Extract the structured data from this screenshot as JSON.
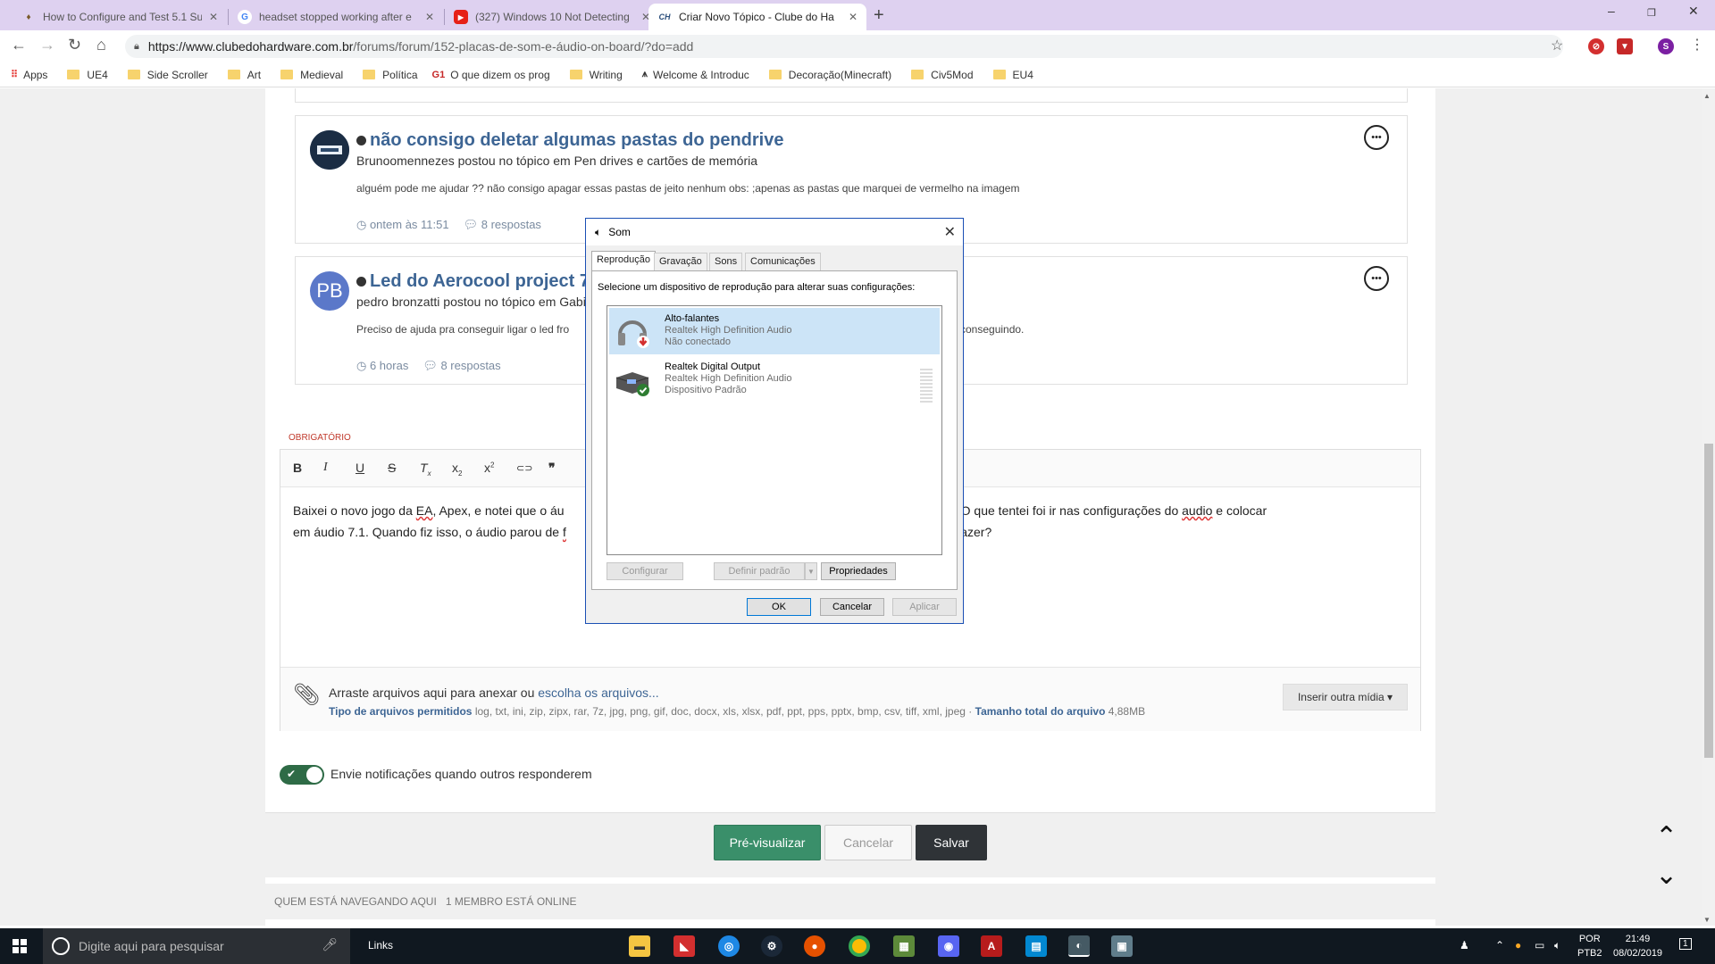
{
  "tabs": [
    {
      "title": "How to Configure and Test 5.1 Su"
    },
    {
      "title": "headset stopped working after e"
    },
    {
      "title": "(327) Windows 10 Not Detecting"
    },
    {
      "title": "Criar Novo Tópico - Clube do Ha"
    }
  ],
  "url": {
    "host": "https://www.clubedohardware.com.br",
    "path": "/forums/forum/152-placas-de-som-e-áudio-on-board/?do=add"
  },
  "bookmarks": [
    "Apps",
    "UE4",
    "Side Scroller",
    "Art",
    "Medieval",
    "Política",
    "O que dizem os prog",
    "Writing",
    "Welcome & Introduc",
    "Decoração(Minecraft)",
    "Civ5Mod",
    "EU4"
  ],
  "profile_initial": "S",
  "posts": [
    {
      "title": "não consigo deletar algumas pastas do pendrive",
      "author_line": "Brunoomennezes postou no tópico em Pen drives e cartões de memória",
      "excerpt": "alguém pode me ajudar ?? não consigo apagar essas pastas de jeito nenhum obs: ;apenas as pastas que marquei de vermelho na imagem",
      "time": "◷ ontem às 11:51",
      "replies": "8 respostas"
    },
    {
      "initials": "PB",
      "title": "Led do Aerocool project 7",
      "author_line": "pedro bronzatti postou no tópico em Gabi",
      "excerpt": "Preciso de ajuda pra conseguir ligar o led fro",
      "excerpt_tail": "conseguindo.",
      "time": "◷ 6 horas",
      "replies": "8 respostas"
    }
  ],
  "required_label": "OBRIGATÓRIO",
  "editor": {
    "line1_a": "Baixei o novo jogo da ",
    "line1_ea": "EA",
    "line1_b": ", Apex, e notei que o áu",
    "line1_c": "s que vi na internet. O que tentei foi ir nas configurações do ",
    "line1_audio": "audio",
    "line1_d": " e colocar",
    "line2_a": "em áudio 7.1. Quando fiz isso, o áudio parou de ",
    "line2_f": "f",
    "line2_b": "ue fazer?"
  },
  "attach": {
    "text": "Arraste arquivos aqui para anexar ou ",
    "link": "escolha os arquivos...",
    "types_label": "Tipo de arquivos permitidos",
    "types": "log, txt, ini, zip, zipx, rar, 7z, jpg, png, gif, doc, docx, xls, xlsx, pdf, ppt, pps, pptx, bmp, csv, tiff, xml, jpeg · ",
    "size_label": "Tamanho total do arquivo",
    "size": "4,88MB",
    "insert_btn": "Inserir outra mídia ▾"
  },
  "notify_label": "Envie notificações quando outros responderem",
  "actions": {
    "preview": "Pré-visualizar",
    "cancel": "Cancelar",
    "save": "Salvar"
  },
  "whos": {
    "label": "QUEM ESTÁ NAVEGANDO AQUI",
    "count": "1 MEMBRO ESTÁ ONLINE"
  },
  "dialog": {
    "title": "Som",
    "tabs": [
      "Reprodução",
      "Gravação",
      "Sons",
      "Comunicações"
    ],
    "instruction": "Selecione um dispositivo de reprodução para alterar suas configurações:",
    "devices": [
      {
        "name": "Alto-falantes",
        "driver": "Realtek High Definition Audio",
        "status": "Não conectado"
      },
      {
        "name": "Realtek Digital Output",
        "driver": "Realtek High Definition Audio",
        "status": "Dispositivo Padrão"
      }
    ],
    "configure": "Configurar",
    "set_default": "Definir padrão",
    "properties": "Propriedades",
    "ok": "OK",
    "cancel": "Cancelar",
    "apply": "Aplicar"
  },
  "taskbar": {
    "search_placeholder": "Digite aqui para pesquisar",
    "links": "Links",
    "lang1": "POR",
    "lang2": "PTB2",
    "time": "21:49",
    "date": "08/02/2019"
  },
  "colors": {
    "accent": "#3d6594",
    "preview_btn": "#3a8f6a",
    "save_btn": "#2f3337",
    "dialog_border": "#1a4fb4",
    "tabbar": "#ded1f0"
  }
}
